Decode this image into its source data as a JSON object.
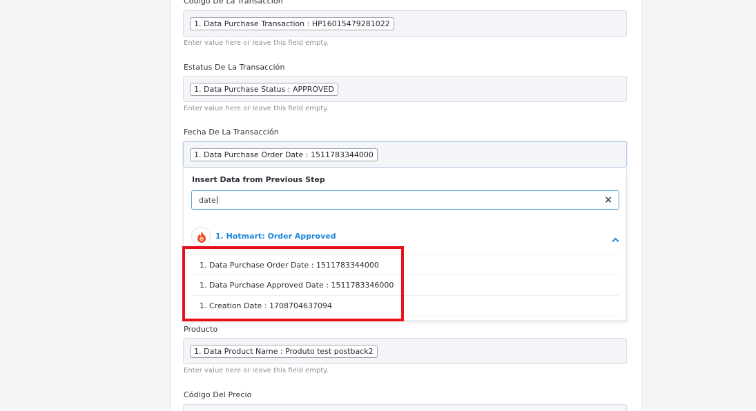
{
  "fields": [
    {
      "label": "Código De La Transacción",
      "token": "1. Data Purchase Transaction : HP16015479281022",
      "hint": "Enter value here or leave this field empty."
    },
    {
      "label": "Estatus De La Transacción",
      "token": "1. Data Purchase Status : APPROVED",
      "hint": "Enter value here or leave this field empty."
    },
    {
      "label": "Fecha De La Transacción",
      "token": "1. Data Purchase Order Date : 1511783344000"
    },
    {
      "label": "Producto",
      "token": "1. Data Product Name : Produto test postback2",
      "hint": "Enter value here or leave this field empty."
    },
    {
      "label": "Código Del Precio"
    }
  ],
  "dropdown": {
    "title": "Insert Data from Previous Step",
    "search_value": "date",
    "app_name": "1. Hotmart: Order Approved",
    "items": [
      "1. Data Purchase Order Date : 1511783344000",
      "1. Data Purchase Approved Date : 1511783346000",
      "1. Creation Date : 1708704637094"
    ]
  },
  "icons": {
    "clear": "close-icon",
    "collapse": "chevron-up-icon",
    "app_logo": "hotmart-flame-icon"
  },
  "colors": {
    "accent": "#1f87d6",
    "highlight": "#e8101b",
    "brand_logo": "#f04e23"
  }
}
